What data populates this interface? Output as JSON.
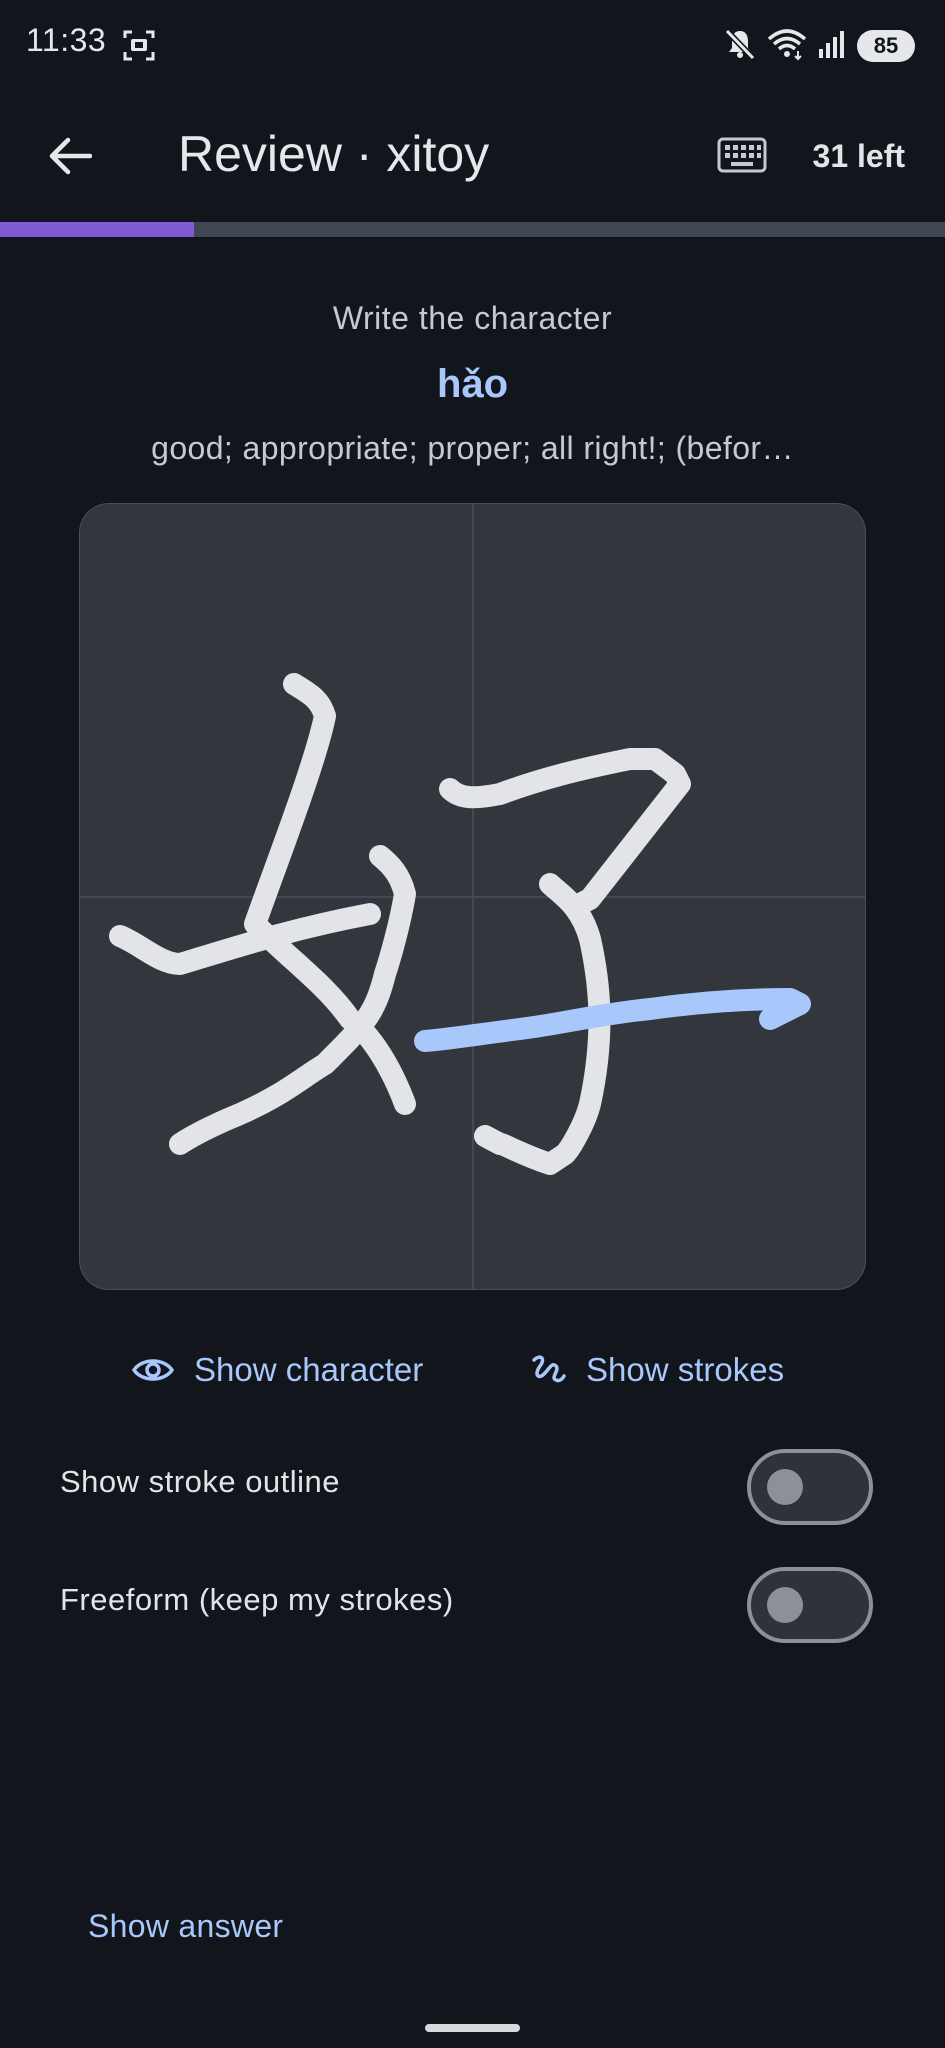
{
  "status_bar": {
    "time": "11:33",
    "battery": "85",
    "icons": [
      "screen-record-icon",
      "mute-icon",
      "wifi-icon",
      "signal-icon",
      "battery-icon"
    ]
  },
  "app_bar": {
    "title": "Review · xitoy",
    "remaining": "31 left",
    "icons": [
      "arrow-back-icon",
      "keyboard-icon"
    ]
  },
  "progress": {
    "fraction": 0.205,
    "fill_color": "#7e5bd0",
    "track_color": "#414654"
  },
  "prompt": {
    "label": "Write the character",
    "pinyin": "hǎo",
    "definition": "good; appropriate; proper; all right!; (befor…"
  },
  "canvas": {
    "background": "#33363d",
    "stroke_color": "#e3e4e8",
    "highlight_color": "#a8c7fa"
  },
  "actions": {
    "show_character": "Show character",
    "show_strokes": "Show strokes"
  },
  "toggles": [
    {
      "label": "Show stroke outline",
      "on": false
    },
    {
      "label": "Freeform (keep my strokes)",
      "on": false
    }
  ],
  "footer": {
    "show_answer": "Show answer"
  },
  "colors": {
    "background": "#12151b",
    "accent": "#a8c7fa",
    "text": "#e3e4e8"
  }
}
